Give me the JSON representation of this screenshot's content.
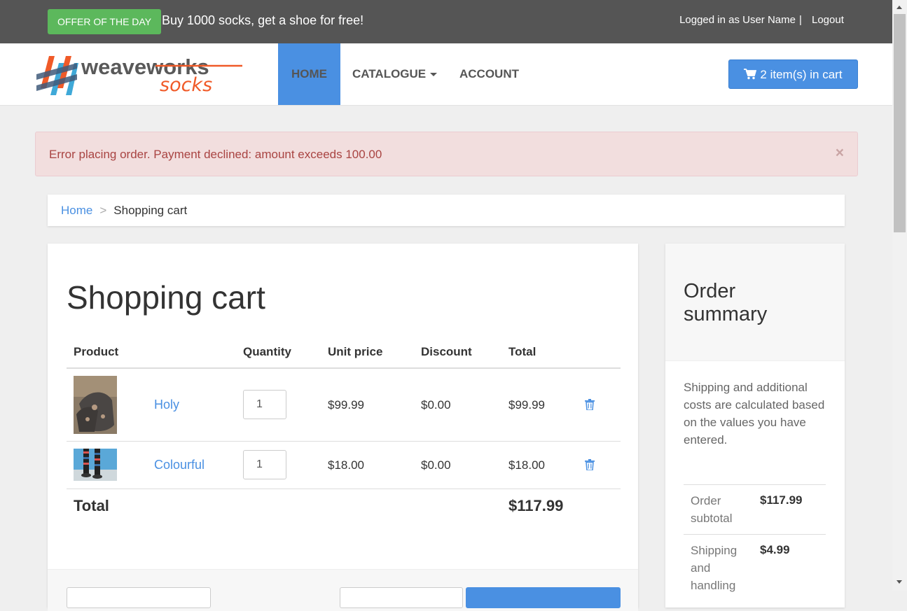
{
  "topbar": {
    "offer_badge": "OFFER OF THE DAY",
    "offer_text": "Buy 1000 socks, get a shoe for free!",
    "login_text": "Logged in as User Name",
    "separator": "|",
    "logout": "Logout"
  },
  "nav": {
    "logo_main": "weaveworks",
    "logo_sub": "socks",
    "items": [
      {
        "label": "HOME",
        "active": true
      },
      {
        "label": "CATALOGUE",
        "dropdown": true
      },
      {
        "label": "ACCOUNT"
      }
    ],
    "cart_button": "2 item(s) in cart"
  },
  "alert": {
    "message": "Error placing order. Payment declined: amount exceeds 100.00",
    "close": "×"
  },
  "breadcrumb": {
    "home": "Home",
    "separator": ">",
    "current": "Shopping cart"
  },
  "cart": {
    "title": "Shopping cart",
    "columns": [
      "Product",
      "Quantity",
      "Unit price",
      "Discount",
      "Total"
    ],
    "rows": [
      {
        "name": "Holy",
        "quantity": "1",
        "unit_price": "$99.99",
        "discount": "$0.00",
        "total": "$99.99"
      },
      {
        "name": "Colourful",
        "quantity": "1",
        "unit_price": "$18.00",
        "discount": "$0.00",
        "total": "$18.00"
      }
    ],
    "total_label": "Total",
    "total_value": "$117.99"
  },
  "summary": {
    "title": "Order summary",
    "note": "Shipping and additional costs are calculated based on the values you have entered.",
    "lines": [
      {
        "label": "Order subtotal",
        "value": "$117.99"
      },
      {
        "label": "Shipping and handling",
        "value": "$4.99"
      }
    ]
  },
  "colors": {
    "accent": "#4a90e2",
    "offer_green": "#5cb85c",
    "topbar": "#555555",
    "alert_bg": "#f2dede",
    "alert_text": "#a94442",
    "logo_orange": "#f05a28"
  }
}
